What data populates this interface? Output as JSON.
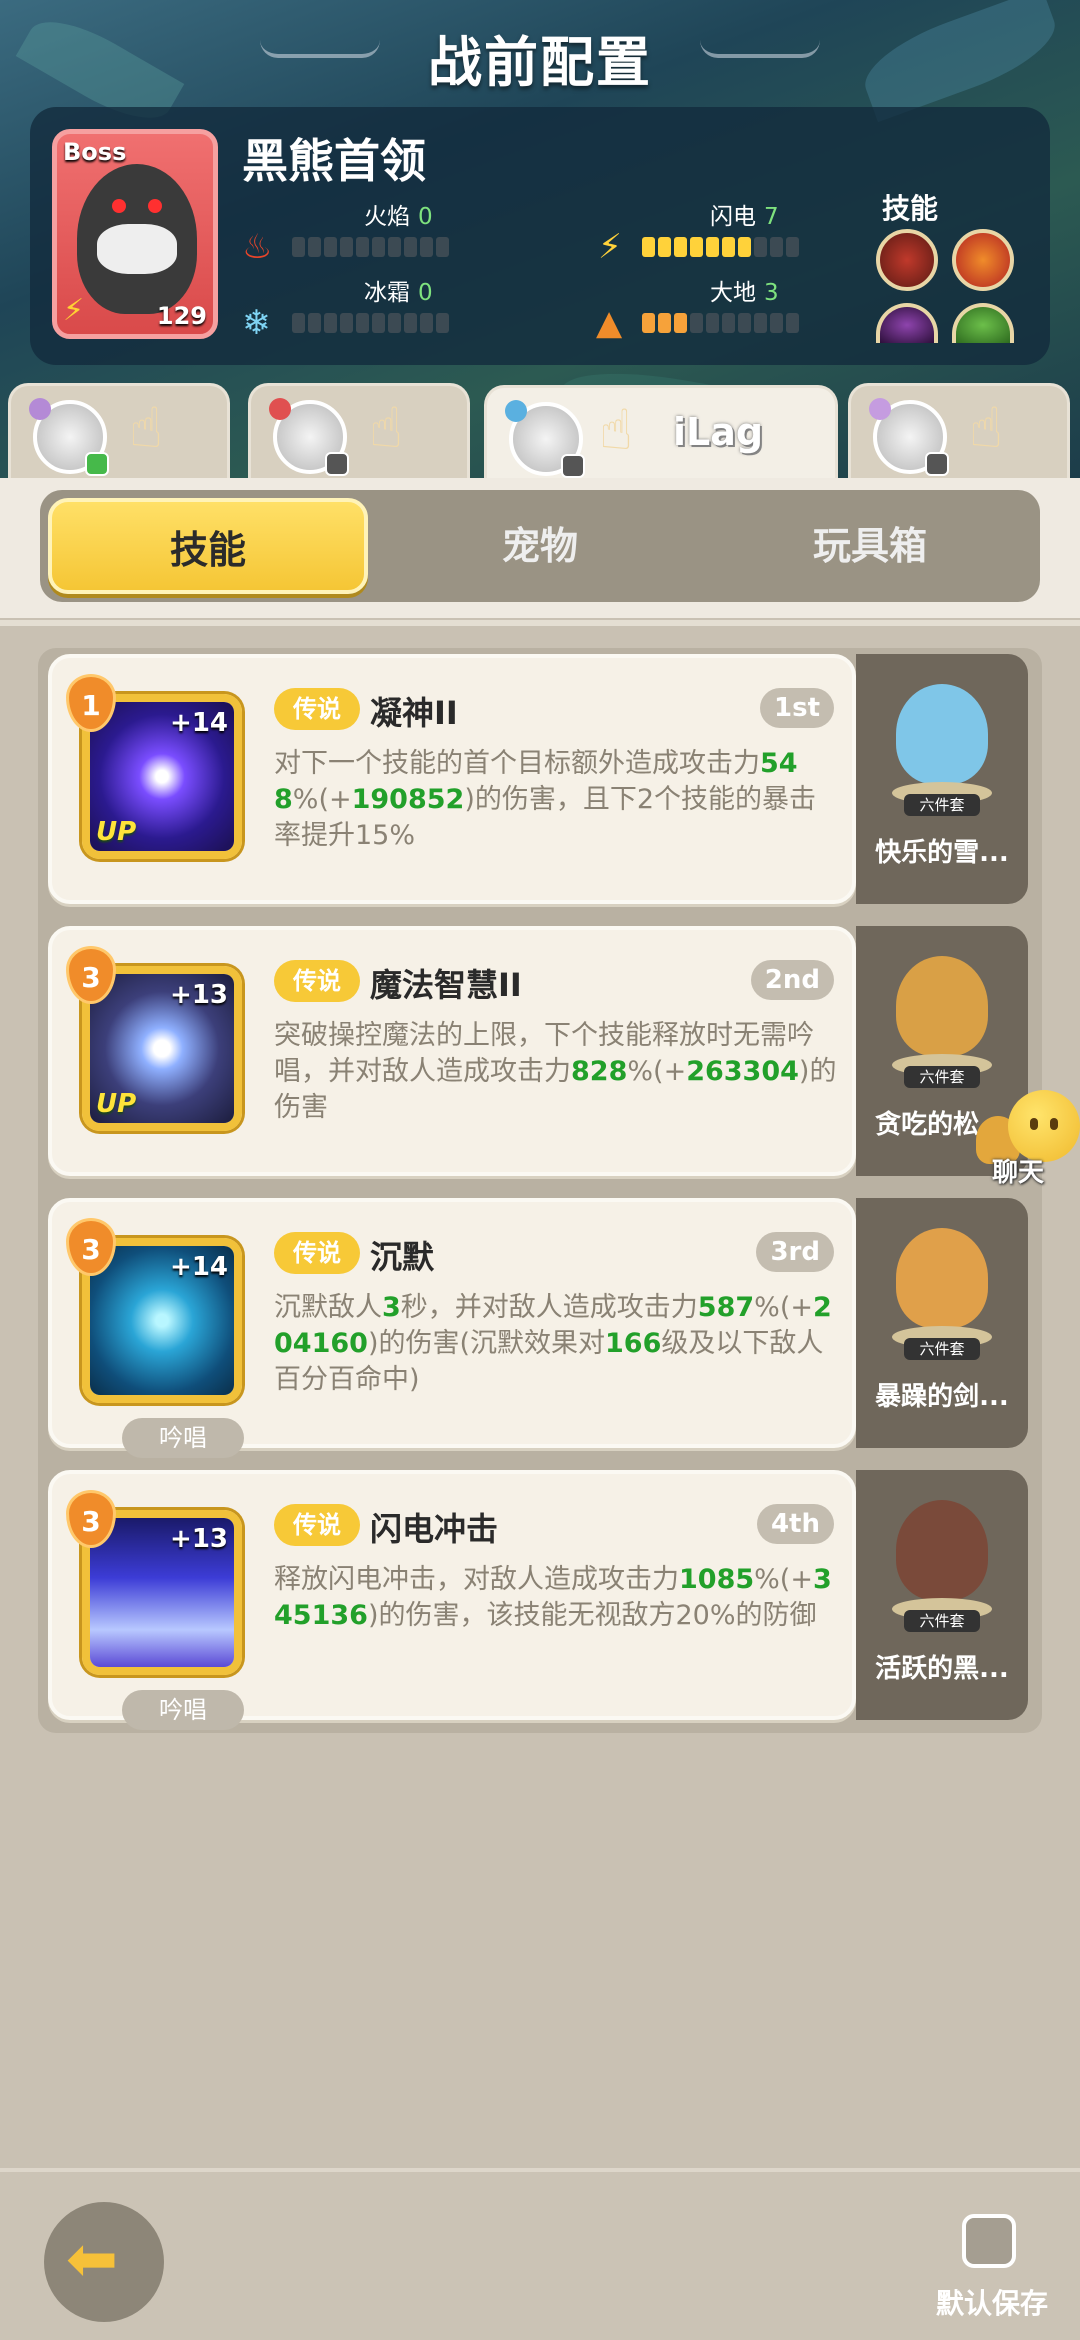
{
  "header": {
    "title": "战前配置"
  },
  "boss": {
    "badge": "Boss",
    "level": "129",
    "name": "黑熊首领",
    "stats": [
      {
        "label": "火焰",
        "value": "0",
        "level": 0,
        "color": "#ffd23a"
      },
      {
        "label": "闪电",
        "value": "7",
        "level": 7,
        "color": "#ffd23a"
      },
      {
        "label": "冰霜",
        "value": "0",
        "level": 0,
        "color": "#ffd23a"
      },
      {
        "label": "大地",
        "value": "3",
        "level": 3,
        "color": "#f6a23a"
      }
    ],
    "skills_label": "技能"
  },
  "players": [
    {
      "name": ""
    },
    {
      "name": ""
    },
    {
      "name": "iLag"
    },
    {
      "name": ""
    }
  ],
  "segment": {
    "tabs": [
      "技能",
      "宠物",
      "玩具箱"
    ],
    "active": 0
  },
  "cards": [
    {
      "rank": "1",
      "plus": "+14",
      "up": "UP",
      "chant": "",
      "tag": "传说",
      "name": "凝神II",
      "order": "1st",
      "desc_parts": [
        {
          "t": "对下一个技能的首个目标额外造成攻击力",
          "g": false
        },
        {
          "t": "548",
          "g": true
        },
        {
          "t": "%(+",
          "g": false
        },
        {
          "t": "190852",
          "g": true
        },
        {
          "t": ")的伤害，且下2个技能的暴击率提升15%",
          "g": false
        }
      ],
      "pet_name": "快乐的雪...",
      "pet_set": "六件套",
      "pet_color": "#7fc6e8"
    },
    {
      "rank": "3",
      "plus": "+13",
      "up": "UP",
      "chant": "",
      "tag": "传说",
      "name": "魔法智慧II",
      "order": "2nd",
      "desc_parts": [
        {
          "t": "突破操控魔法的上限，下个技能释放时无需吟唱，并对敌人造成攻击力",
          "g": false
        },
        {
          "t": "828",
          "g": true
        },
        {
          "t": "%(+",
          "g": false
        },
        {
          "t": "263304",
          "g": true
        },
        {
          "t": ")的伤害",
          "g": false
        }
      ],
      "pet_name": "贪吃的松...",
      "pet_set": "六件套",
      "pet_color": "#d9a046"
    },
    {
      "rank": "3",
      "plus": "+14",
      "up": "",
      "chant": "吟唱",
      "tag": "传说",
      "name": "沉默",
      "order": "3rd",
      "desc_parts": [
        {
          "t": "沉默敌人",
          "g": false
        },
        {
          "t": "3",
          "g": true
        },
        {
          "t": "秒，并对敌人造成攻击力",
          "g": false
        },
        {
          "t": "587",
          "g": true
        },
        {
          "t": "%(+",
          "g": false
        },
        {
          "t": "204160",
          "g": true
        },
        {
          "t": ")的伤害(沉默效果对",
          "g": false
        },
        {
          "t": "166",
          "g": true
        },
        {
          "t": "级及以下敌人百分百命中)",
          "g": false
        }
      ],
      "pet_name": "暴躁的剑...",
      "pet_set": "六件套",
      "pet_color": "#e0a04a"
    },
    {
      "rank": "3",
      "plus": "+13",
      "up": "",
      "chant": "吟唱",
      "tag": "传说",
      "name": "闪电冲击",
      "order": "4th",
      "desc_parts": [
        {
          "t": "释放闪电冲击，对敌人造成攻击力",
          "g": false
        },
        {
          "t": "1085",
          "g": true
        },
        {
          "t": "%(+",
          "g": false
        },
        {
          "t": "345136",
          "g": true
        },
        {
          "t": ")的伤害，该技能无视敌方20%的防御",
          "g": false
        }
      ],
      "pet_name": "活跃的黑...",
      "pet_set": "六件套",
      "pet_color": "#7a4a3a"
    }
  ],
  "chat": {
    "label": "聊天"
  },
  "footer": {
    "save_label": "默认保存"
  },
  "colors": {
    "accent_yellow": "#f7c937",
    "green_number": "#22a02a",
    "panel": "#6f675b"
  }
}
